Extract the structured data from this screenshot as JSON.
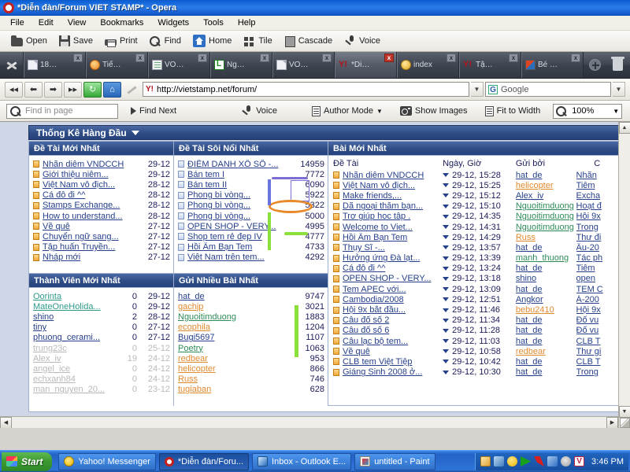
{
  "window": {
    "title": "*Diễn đàn/Forum VIET STAMP* - Opera",
    "logo_icon": "opera-logo"
  },
  "menu": {
    "items": [
      "File",
      "Edit",
      "View",
      "Bookmarks",
      "Widgets",
      "Tools",
      "Help"
    ]
  },
  "toolbar": {
    "buttons": [
      {
        "label": "Open",
        "icon": "folder-icon"
      },
      {
        "label": "Save",
        "icon": "floppy-disk-icon"
      },
      {
        "label": "Print",
        "icon": "printer-icon"
      },
      {
        "label": "Find",
        "icon": "magnifier-icon"
      },
      {
        "label": "Home",
        "icon": "home-icon"
      },
      {
        "label": "Tile",
        "icon": "tile-icon"
      },
      {
        "label": "Cascade",
        "icon": "cascade-icon"
      },
      {
        "label": "Voice",
        "icon": "microphone-icon"
      }
    ]
  },
  "tabs": [
    {
      "label": "18…",
      "icon": "document-icon",
      "active": false
    },
    {
      "label": "Tiế…",
      "icon": "orange-circle-icon",
      "active": false
    },
    {
      "label": "VO…",
      "icon": "lined-document-icon",
      "active": false
    },
    {
      "label": "Ng…",
      "icon": "green-sheet-icon",
      "active": false
    },
    {
      "label": "VO…",
      "icon": "document-icon",
      "active": false
    },
    {
      "label": "*Di…",
      "icon": "yahoo-icon",
      "active": true
    },
    {
      "label": "index",
      "icon": "coin-icon",
      "active": false
    },
    {
      "label": "Tậ…",
      "icon": "yahoo-icon",
      "active": false
    },
    {
      "label": "Bé …",
      "icon": "colorful-icon",
      "active": false
    }
  ],
  "tab_close_label": "x",
  "address": {
    "back_icon": "rewind-icon",
    "prev_icon": "arrow-left-icon",
    "next_icon": "arrow-right-icon",
    "forward_icon": "fast-forward-icon",
    "reload_icon": "reload-icon",
    "home_icon": "home-icon",
    "pen_icon": "pen-icon",
    "url": "http://vietstamp.net/forum/",
    "url_favicon": "yahoo-icon",
    "search_placeholder": "Google",
    "search_engine_icon": "google-icon"
  },
  "findbar": {
    "find_placeholder": "Find in page",
    "find_next": "Find Next",
    "voice": "Voice",
    "author_mode": "Author Mode",
    "show_images": "Show Images",
    "fit_to_width": "Fit to Width",
    "zoom": "100%"
  },
  "content": {
    "panel_title": "Thống Kê Hàng Đầu",
    "latest_topics": {
      "header": "Đề Tài Mới Nhất",
      "rows": [
        {
          "title": "Nhãn diêm VNDCCH",
          "date": "29-12"
        },
        {
          "title": "Giới thiệu niêm...",
          "date": "29-12"
        },
        {
          "title": "Việt Nam vô địch...",
          "date": "28-12"
        },
        {
          "title": "Cá đô đi ^^",
          "date": "28-12"
        },
        {
          "title": "Stamps Exchange...",
          "date": "28-12"
        },
        {
          "title": "How to understand...",
          "date": "28-12"
        },
        {
          "title": "Về quê",
          "date": "27-12"
        },
        {
          "title": "Chuyển ngữ sang...",
          "date": "27-12"
        },
        {
          "title": "Tập huấn Truyền...",
          "date": "27-12"
        },
        {
          "title": "Nháp mới",
          "date": "27-12"
        }
      ]
    },
    "hottest_topics": {
      "header": "Đề Tài Sôi Nổi Nhất",
      "rows": [
        {
          "title": "ĐIỂM DANH XỔ SỐ -...",
          "views": "14959"
        },
        {
          "title": "Bán tem I",
          "views": "7772"
        },
        {
          "title": "Bán tem II",
          "views": "6090"
        },
        {
          "title": "Phong bì vòng...",
          "views": "5922"
        },
        {
          "title": "Phong bì vòng...",
          "views": "5322"
        },
        {
          "title": "Phong bì vòng...",
          "views": "5000"
        },
        {
          "title": "OPEN SHOP - VERY...",
          "views": "4995"
        },
        {
          "title": "Shop tem rẻ đẹp IV",
          "views": "4777"
        },
        {
          "title": "Hồi Âm Bạn Tem",
          "views": "4733"
        },
        {
          "title": "Việt Nam trên tem...",
          "views": "4292"
        }
      ]
    },
    "new_members": {
      "header": "Thành Viên Mới Nhất",
      "rows": [
        {
          "name": "Oorinta",
          "posts": "0",
          "date": "29-12",
          "color": "teal",
          "dim": false
        },
        {
          "name": "MateOneHolida...",
          "posts": "0",
          "date": "29-12",
          "color": "teal",
          "dim": false
        },
        {
          "name": "shino",
          "posts": "2",
          "date": "28-12",
          "color": "blue",
          "dim": false
        },
        {
          "name": "tiny",
          "posts": "0",
          "date": "27-12",
          "color": "blue",
          "dim": false
        },
        {
          "name": "phuong_cerami...",
          "posts": "0",
          "date": "27-12",
          "color": "blue",
          "dim": false
        },
        {
          "name": "trung23c",
          "posts": "0",
          "date": "25-12",
          "color": "blue",
          "dim": true
        },
        {
          "name": "Alex_iv",
          "posts": "19",
          "date": "24-12",
          "color": "blue",
          "dim": true
        },
        {
          "name": "angel_ice",
          "posts": "0",
          "date": "24-12",
          "color": "blue",
          "dim": true
        },
        {
          "name": "echxanh84",
          "posts": "0",
          "date": "24-12",
          "color": "blue",
          "dim": true
        },
        {
          "name": "man_nguyen_20...",
          "posts": "0",
          "date": "23-12",
          "color": "blue",
          "dim": true
        }
      ]
    },
    "top_posters": {
      "header": "Gửi Nhiều Bài Nhất",
      "rows": [
        {
          "name": "hat_de",
          "posts": "9747",
          "color": "blue"
        },
        {
          "name": "gachjp",
          "posts": "3021",
          "color": "orange"
        },
        {
          "name": "Nguoitimduong",
          "posts": "1883",
          "color": "green"
        },
        {
          "name": "ecophila",
          "posts": "1204",
          "color": "orange"
        },
        {
          "name": "Bugi5697",
          "posts": "1107",
          "color": "blue"
        },
        {
          "name": "Poetry",
          "posts": "1063",
          "color": "green"
        },
        {
          "name": "redbear",
          "posts": "953",
          "color": "orange"
        },
        {
          "name": "helicopter",
          "posts": "866",
          "color": "orange"
        },
        {
          "name": "Russ",
          "posts": "746",
          "color": "orange"
        },
        {
          "name": "tugiaban",
          "posts": "628",
          "color": "orange"
        }
      ]
    },
    "latest_posts": {
      "header": "Bài Mới Nhất",
      "columns": [
        "Đề Tài",
        "Ngày, Giờ",
        "Gửi bởi",
        "C"
      ],
      "rows": [
        {
          "topic": "Nhãn diêm VNDCCH",
          "datetime": "29-12, 15:28",
          "user": "hat_de",
          "user_color": "blue",
          "cat": "Nhãn "
        },
        {
          "topic": "Việt Nam vô địch...",
          "datetime": "29-12, 15:25",
          "user": "helicopter",
          "user_color": "orange",
          "cat": "Tiêm "
        },
        {
          "topic": "Make friends,...",
          "datetime": "29-12, 15:12",
          "user": "Alex_iv",
          "user_color": "blue",
          "cat": "Excha"
        },
        {
          "topic": "Dã ngoại thăm bạn...",
          "datetime": "29-12, 15:10",
          "user": "Nguoitimduong",
          "user_color": "green",
          "cat": "Hoạt đ"
        },
        {
          "topic": "Trợ giúp học tập .",
          "datetime": "29-12, 14:35",
          "user": "Nguoitimduong",
          "user_color": "green",
          "cat": "Hội 9x"
        },
        {
          "topic": "Welcome to Viet...",
          "datetime": "29-12, 14:31",
          "user": "Nguoitimduong",
          "user_color": "green",
          "cat": "Trong "
        },
        {
          "topic": "Hồi Âm Bạn Tem",
          "datetime": "29-12, 14:29",
          "user": "Russ",
          "user_color": "orange",
          "cat": "Thư đi"
        },
        {
          "topic": "Thụy Sĩ -...",
          "datetime": "29-12, 13:57",
          "user": "hat_de",
          "user_color": "blue",
          "cat": "Âu-20"
        },
        {
          "topic": "Hưởng ứng Đà lạt...",
          "datetime": "29-12, 13:39",
          "user": "manh_thuong",
          "user_color": "green",
          "cat": "Tác ph"
        },
        {
          "topic": "Cá đô đi ^^",
          "datetime": "29-12, 13:24",
          "user": "hat_de",
          "user_color": "blue",
          "cat": "Tiêm "
        },
        {
          "topic": "OPEN SHOP - VERY...",
          "datetime": "29-12, 13:18",
          "user": "shino",
          "user_color": "blue",
          "cat": "open"
        },
        {
          "topic": "Tem APEC với...",
          "datetime": "29-12, 13:09",
          "user": "hat_de",
          "user_color": "blue",
          "cat": "TEM C"
        },
        {
          "topic": "Cambodia/2008",
          "datetime": "29-12, 12:51",
          "user": "Angkor",
          "user_color": "blue",
          "cat": "Á-200"
        },
        {
          "topic": "Hội 9x bắt đầu...",
          "datetime": "29-12, 11:46",
          "user": "bebu2410",
          "user_color": "orange",
          "cat": "Hội 9x"
        },
        {
          "topic": "Câu đố số 2",
          "datetime": "29-12, 11:34",
          "user": "hat_de",
          "user_color": "blue",
          "cat": "Đố vu"
        },
        {
          "topic": "Câu đố số 6",
          "datetime": "29-12, 11:28",
          "user": "hat_de",
          "user_color": "blue",
          "cat": "Đố vu"
        },
        {
          "topic": "Câu lạc bộ tem...",
          "datetime": "29-12, 11:03",
          "user": "hat_de",
          "user_color": "blue",
          "cat": "CLB T"
        },
        {
          "topic": "Về quê",
          "datetime": "29-12, 10:58",
          "user": "redbear",
          "user_color": "orange",
          "cat": "Thư gi"
        },
        {
          "topic": "CLB tem Việt Tiệp",
          "datetime": "29-12, 10:42",
          "user": "hat_de",
          "user_color": "blue",
          "cat": "CLB T"
        },
        {
          "topic": "Giáng Sinh 2008 ở...",
          "datetime": "29-12, 10:30",
          "user": "hat_de",
          "user_color": "blue",
          "cat": "Trong "
        }
      ]
    }
  },
  "annotations": {
    "purple_underline_on": "7772",
    "purple_rect_on": [
      "5922",
      "5322"
    ],
    "orange_ellipse_on": "5000",
    "green_highlight_on": "4733"
  },
  "taskbar": {
    "start_label": "Start",
    "items": [
      {
        "label": "Yahoo! Messenger",
        "icon": "smiley-icon",
        "active": false
      },
      {
        "label": "*Diễn đàn/Foru...",
        "icon": "opera-icon",
        "active": true
      },
      {
        "label": "Inbox - Outlook E...",
        "icon": "outlook-icon",
        "active": false
      },
      {
        "label": "untitled - Paint",
        "icon": "paint-icon",
        "active": false
      }
    ],
    "tray_icons": [
      "mail-icon",
      "network-icon",
      "yahoo-smiley-icon",
      "media-play-icon",
      "kaspersky-icon",
      "update-icon",
      "opera-tray-icon",
      "v-icon"
    ],
    "clock": "3:46 PM"
  },
  "colors": {
    "title_blue": "#0f62d6",
    "panel_header": "#2e4c86",
    "link": "#27408b",
    "link_green": "#2e8b57",
    "link_orange": "#e08a2e",
    "annotation_purple": "#7b6fd6",
    "annotation_orange": "#e8892a",
    "annotation_green": "#8ce03c",
    "taskbar_blue": "#2462c4",
    "start_green": "#3d9b31"
  }
}
